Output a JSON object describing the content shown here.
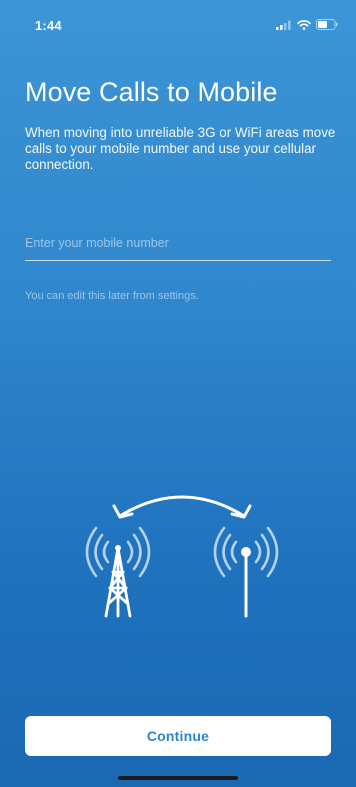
{
  "status_bar": {
    "time": "1:44",
    "icons": [
      "cellular-signal-icon",
      "wifi-icon",
      "battery-icon"
    ]
  },
  "page": {
    "title": "Move Calls to Mobile",
    "description": "When moving into unreliable 3G or WiFi areas move calls to your mobile number and use your cellular connection.",
    "mobile_number_field": {
      "value": "",
      "placeholder": "Enter your mobile number"
    },
    "helper_text": "You can edit this later from settings.",
    "illustration": {
      "icons": [
        "transfer-arrow-icon",
        "cell-tower-icon",
        "mobile-antenna-icon"
      ]
    }
  },
  "actions": {
    "continue_label": "Continue"
  },
  "colors": {
    "background_top": "#3c95d6",
    "background_bottom": "#1b69b3",
    "button_background": "#ffffff",
    "button_text": "#2d86cc"
  }
}
